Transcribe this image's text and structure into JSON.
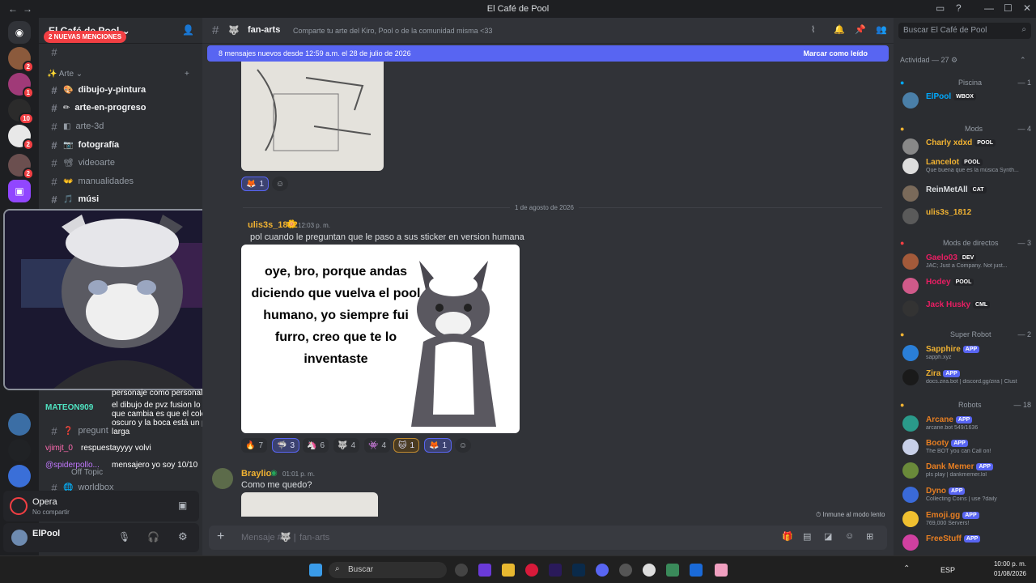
{
  "window": {
    "title": "El Café de Pool"
  },
  "server": {
    "name": "El Café de Pool",
    "mentions_pill": "2 NUEVAS MENCIONES"
  },
  "guild_badges": [
    "2",
    "1",
    "10",
    "2",
    "2"
  ],
  "categories": {
    "arte": "Arte"
  },
  "channels": [
    {
      "name": "dibujo-y-pintura",
      "unread": true
    },
    {
      "name": "arte-en-progreso",
      "unread": true
    },
    {
      "name": "arte-3d",
      "unread": false
    },
    {
      "name": "fotografía",
      "unread": true
    },
    {
      "name": "videoarte",
      "unread": false
    },
    {
      "name": "manualidades",
      "unread": false
    },
    {
      "name": "músi",
      "unread": true
    }
  ],
  "lower_channels": {
    "preguntas": "pregunt",
    "offtopic": "Off Topic",
    "worldbox": "worldbox"
  },
  "chat_overlay": [
    {
      "user": "",
      "text": "personaje como personalidades"
    },
    {
      "user": "MATEON909",
      "text": "el dibujo de pvz fusion lo que yo noté que cambia es que el color es más oscuro y la boca está un poco más larga"
    },
    {
      "user": "vjimjt_0",
      "text": "respuestayyyy volvi"
    },
    {
      "user": "@spiderpollo...",
      "text": "mensajero yo soy 10/10"
    }
  ],
  "voice": {
    "app": "Opera",
    "status": "No compartir"
  },
  "user": {
    "name": "ElPool"
  },
  "channel_header": {
    "name": "fan-arts",
    "topic": "Comparte tu arte del Kiro, Pool o de la comunidad misma <33"
  },
  "new_messages_bar": {
    "text": "8 mensajes nuevos desde 12:59 a.m. el 28 de julio de 2026",
    "action": "Marcar como leído"
  },
  "top_reaction": {
    "count": "1"
  },
  "date_divider": "1 de agosto de 2026",
  "message1": {
    "author": "ulis3s_1812",
    "time": "12:03 p. m.",
    "text": "pol cuando le preguntan que le paso a sus sticker en version humana",
    "image_caption": "oye, bro, porque andas diciendo que vuelva el pool humano, yo siempre fui furro, creo que te lo inventaste"
  },
  "message1_reactions": [
    {
      "emoji": "🔥",
      "count": "7"
    },
    {
      "emoji": "🦈",
      "count": "3"
    },
    {
      "emoji": "🦄",
      "count": "6"
    },
    {
      "emoji": "🐺",
      "count": "4"
    },
    {
      "emoji": "👾",
      "count": "4"
    },
    {
      "emoji": "🐱",
      "count": "1"
    },
    {
      "emoji": "🦊",
      "count": "1"
    }
  ],
  "message2": {
    "author": "Braylio",
    "time": "01:01 p. m.",
    "text": "Como me quedo?"
  },
  "slowmode": "Inmune al modo lento",
  "composer": {
    "placeholder": "Mensaje #",
    "channel": "fan-arts"
  },
  "search": {
    "placeholder": "Buscar El Café de Pool"
  },
  "activity": {
    "label": "Actividad — 27"
  },
  "member_groups": [
    {
      "name": "Piscina",
      "count": "— 1"
    },
    {
      "name": "Mods",
      "count": "— 4"
    },
    {
      "name": "Mods de directos",
      "count": "— 3"
    },
    {
      "name": "Super Robot",
      "count": "— 2"
    },
    {
      "name": "Robots",
      "count": "— 18"
    }
  ],
  "members": [
    {
      "name": "ElPool",
      "tag": "WBOX",
      "sub": "",
      "color": "#00a8fc"
    },
    {
      "name": "Charly xdxd",
      "tag": "POOL",
      "sub": "",
      "color": "#f0b232"
    },
    {
      "name": "Lancelot",
      "tag": "POOL",
      "sub": "Que buena que es la música Synth...",
      "color": "#f0b232"
    },
    {
      "name": "ReinMetAll",
      "tag": "CAT",
      "sub": "",
      "color": "#dbdee1"
    },
    {
      "name": "ulis3s_1812",
      "tag": "",
      "sub": "",
      "color": "#f0b232"
    },
    {
      "name": "Gaelo03",
      "tag": "DEV",
      "sub": "JAC; Just a Company. Not just...",
      "color": "#e91e63"
    },
    {
      "name": "Hodey",
      "tag": "POOL",
      "sub": "",
      "color": "#e91e63"
    },
    {
      "name": "Jack Husky",
      "tag": "CML",
      "sub": "",
      "color": "#e91e63"
    },
    {
      "name": "Sapphire",
      "tag": "APP",
      "sub": "sapph.xyz",
      "color": "#f0b232"
    },
    {
      "name": "Zira",
      "tag": "APP",
      "sub": "docs.zira.bot | discord.gg/zira | Clust",
      "color": "#f0b232"
    },
    {
      "name": "Arcane",
      "tag": "APP",
      "sub": "arcane.bot 549/1636",
      "color": "#e67e22"
    },
    {
      "name": "Booty",
      "tag": "APP",
      "sub": "The BOT you can Call on!",
      "color": "#e67e22"
    },
    {
      "name": "Dank Memer",
      "tag": "APP",
      "sub": "pls play | dankmemer.lol",
      "color": "#e67e22"
    },
    {
      "name": "Dyno",
      "tag": "APP",
      "sub": "Collecting Coins | use ?daily",
      "color": "#e67e22"
    },
    {
      "name": "Emoji.gg",
      "tag": "APP",
      "sub": "769,000 Servers!",
      "color": "#e67e22"
    },
    {
      "name": "FreeStuff",
      "tag": "APP",
      "sub": "",
      "color": "#e67e22"
    }
  ],
  "taskbar": {
    "search": "Buscar",
    "lang": "ESP",
    "time": "10:00 p. m.",
    "date": "01/08/2026"
  },
  "colors": {
    "accent": "#5865f2",
    "bg_main": "#313338",
    "bg_sidebar": "#2b2d31"
  }
}
